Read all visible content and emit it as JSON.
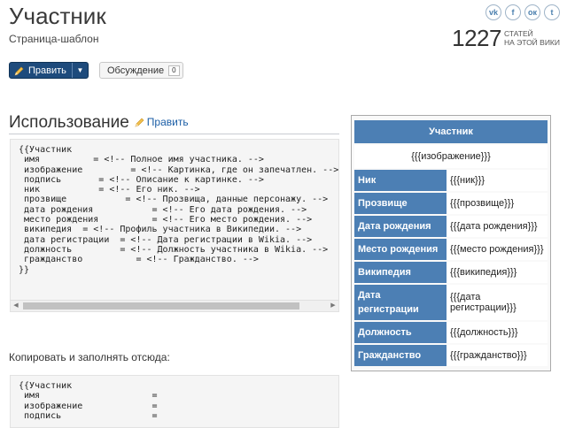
{
  "page": {
    "title": "Участник",
    "subtitle": "Страница-шаблон"
  },
  "social": [
    {
      "name": "vk-icon",
      "glyph": "vk"
    },
    {
      "name": "facebook-icon",
      "glyph": "f"
    },
    {
      "name": "odnoklassniki-icon",
      "glyph": "ок"
    },
    {
      "name": "twitter-icon",
      "glyph": "t"
    }
  ],
  "stats": {
    "count": "1227",
    "label_line1": "СТАТЕЙ",
    "label_line2": "НА ЭТОЙ ВИКИ"
  },
  "toolbar": {
    "edit_label": "Править",
    "talk_label": "Обсуждение",
    "talk_count": "0"
  },
  "usage": {
    "heading": "Использование",
    "edit_link": "Править"
  },
  "code_block_1": "{{Участник\n имя          = <!-- Полное имя участника. -->\n изображение         = <!-- Картинка, где он запечатлен. -->\n подпись       = <!-- Описание к картинке. -->\n ник           = <!-- Его ник. -->\n прозвище           = <!-- Прозвища, данные персонажу. -->\n дата рождения           = <!-- Его дата рождения. -->\n место рождения          = <!-- Его место рождения. -->\n википедия  = <!-- Профиль участника в Википедии. -->\n дата регистрации  = <!-- Дата регистрации в Wikia. -->\n должность         = <!-- Должность участника в Wikia. -->\n гражданство          = <!-- Гражданство. -->\n}}",
  "copy_text": "Копировать и заполнять отсюда:",
  "code_block_2": "{{Участник\n имя                     =\n изображение             =\n подпись                 =",
  "infobox": {
    "title": "Участник",
    "image": "{{{изображение}}}",
    "rows": [
      {
        "label": "Ник",
        "value": "{{{ник}}}"
      },
      {
        "label": "Прозвище",
        "value": "{{{прозвище}}}"
      },
      {
        "label": "Дата рождения",
        "value": "{{{дата рождения}}}"
      },
      {
        "label": "Место рождения",
        "value": "{{{место рождения}}}"
      },
      {
        "label": "Википедия",
        "value": "{{{википедия}}}"
      },
      {
        "label": "Дата регистрации",
        "value": "{{{дата регистрации}}}"
      },
      {
        "label": "Должность",
        "value": "{{{должность}}}"
      },
      {
        "label": "Гражданство",
        "value": "{{{гражданство}}}"
      }
    ]
  },
  "colors": {
    "accent": "#4c7fb4",
    "edit_button": "#1e4b7c",
    "link": "#1b5ea6"
  }
}
